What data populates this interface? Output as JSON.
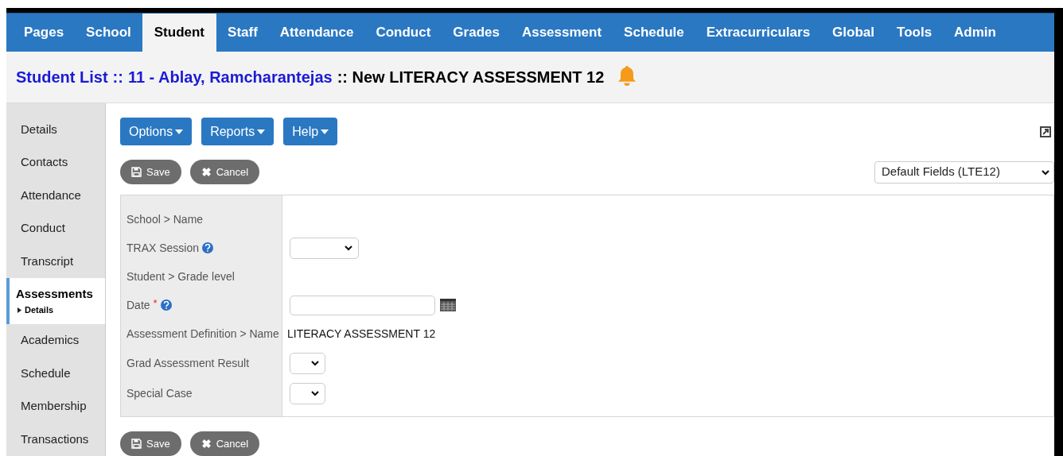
{
  "nav_tabs": [
    {
      "label": "Pages",
      "selected": false
    },
    {
      "label": "School",
      "selected": false
    },
    {
      "label": "Student",
      "selected": true
    },
    {
      "label": "Staff",
      "selected": false
    },
    {
      "label": "Attendance",
      "selected": false
    },
    {
      "label": "Conduct",
      "selected": false
    },
    {
      "label": "Grades",
      "selected": false
    },
    {
      "label": "Assessment",
      "selected": false
    },
    {
      "label": "Schedule",
      "selected": false
    },
    {
      "label": "Extracurriculars",
      "selected": false
    },
    {
      "label": "Global",
      "selected": false
    },
    {
      "label": "Tools",
      "selected": false
    },
    {
      "label": "Admin",
      "selected": false
    }
  ],
  "breadcrumb": [
    {
      "text": "Student List",
      "kind": "link"
    },
    {
      "text": "::",
      "kind": "separator"
    },
    {
      "text": "11 - Ablay, Ramcharantejas",
      "kind": "link"
    },
    {
      "text": ":: New LITERACY ASSESSMENT 12",
      "kind": "text"
    }
  ],
  "sidebar": {
    "items": [
      {
        "label": "Details",
        "selected": false
      },
      {
        "label": "Contacts",
        "selected": false
      },
      {
        "label": "Attendance",
        "selected": false
      },
      {
        "label": "Conduct",
        "selected": false
      },
      {
        "label": "Transcript",
        "selected": false
      },
      {
        "label": "Assessments",
        "selected": true,
        "children": [
          {
            "label": "Details"
          }
        ]
      },
      {
        "label": "Academics",
        "selected": false
      },
      {
        "label": "Schedule",
        "selected": false
      },
      {
        "label": "Membership",
        "selected": false
      },
      {
        "label": "Transactions",
        "selected": false
      }
    ]
  },
  "menu_buttons": [
    "Options",
    "Reports",
    "Help"
  ],
  "top_actions": [
    "Save",
    "Cancel"
  ],
  "field_set": {
    "value": "Default Fields (LTE12)"
  },
  "fields": [
    {
      "label": "School > Name",
      "kind": "readonly",
      "help": false
    },
    {
      "label": "TRAX Session",
      "kind": "select",
      "help": true
    },
    {
      "label": "Student > Grade level",
      "kind": "readonly",
      "help": false
    },
    {
      "label": "Date",
      "kind": "date",
      "required_mark": "*",
      "help": true
    },
    {
      "label": "Assessment Definition > Name",
      "kind": "readonly",
      "help": false,
      "value": "LITERACY ASSESSMENT 12"
    },
    {
      "label": "Grad Assessment Result",
      "kind": "compact-select",
      "help": false
    },
    {
      "label": "Special Case",
      "kind": "compact-select",
      "help": false
    }
  ],
  "bottom_actions": [
    "Save",
    "Cancel"
  ]
}
